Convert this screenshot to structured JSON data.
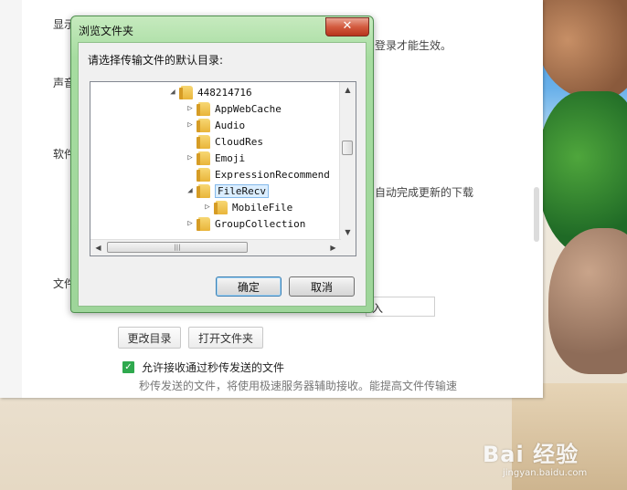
{
  "settings": {
    "labels": {
      "display": "显示",
      "sound": "声音",
      "software": "软件",
      "file": "文件"
    },
    "hints": {
      "login_effect": "登录才能生效。",
      "auto_update": "自动完成更新的下载"
    },
    "path_value": "入",
    "change_dir_button": "更改目录",
    "open_folder_button": "打开文件夹",
    "second_transfer_checkbox": "允许接收通过秒传发送的文件",
    "second_transfer_desc": "秒传发送的文件，将使用极速服务器辅助接收。能提高文件传输速"
  },
  "dialog": {
    "title": "浏览文件夹",
    "close_glyph": "✕",
    "prompt": "请选择传输文件的默认目录:",
    "tree": [
      {
        "label": "448214716",
        "expander": "◢",
        "depth": 0
      },
      {
        "label": "AppWebCache",
        "expander": "▷",
        "depth": 1
      },
      {
        "label": "Audio",
        "expander": "▷",
        "depth": 1
      },
      {
        "label": "CloudRes",
        "expander": "",
        "depth": 1
      },
      {
        "label": "Emoji",
        "expander": "▷",
        "depth": 1
      },
      {
        "label": "ExpressionRecommend",
        "expander": "",
        "depth": 1
      },
      {
        "label": "FileRecv",
        "expander": "◢",
        "depth": 1,
        "selected": true
      },
      {
        "label": "MobileFile",
        "expander": "▷",
        "depth": 2
      },
      {
        "label": "GroupCollection",
        "expander": "▷",
        "depth": 1
      }
    ],
    "ok_button": "确定",
    "cancel_button": "取消"
  },
  "desktop": {
    "watermark": "Bai 经验",
    "watermark_sub": "jingyan.baidu.com"
  }
}
